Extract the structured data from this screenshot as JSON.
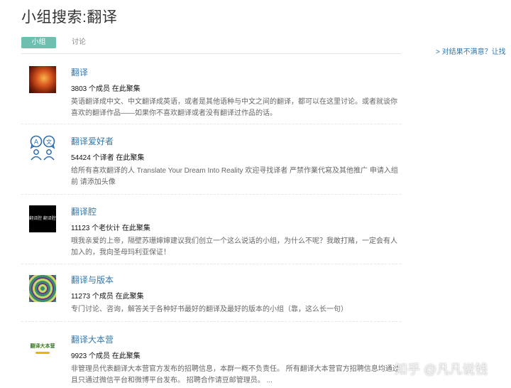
{
  "page_title": "小组搜索:翻译",
  "tabs": [
    {
      "label": "小组",
      "active": true
    },
    {
      "label": "讨论",
      "active": false
    }
  ],
  "side_link": "> 对结果不满意？让找",
  "groups": [
    {
      "name": "翻译",
      "count": "3803 个成员 在此聚集",
      "description": "英语翻译成中文、中文翻译成英语，或者是其他语种与中文之间的翻译，都可以在这里讨论。或者就谈你喜欢的翻译作品——如果你不喜欢翻译或者没有翻译过作品的话。",
      "icon": "fire-face-avatar"
    },
    {
      "name": "翻译爱好者",
      "count": "54424 个译者 在此聚集",
      "description": "给所有喜欢翻译的人 Translate Your Dream Into Reality  欢迎寻找译者  严禁作業代寫及其他推广 申请入组前 请添加头像",
      "icon": "translation-chat-icon"
    },
    {
      "name": "翻译腔",
      "count": "11123 个老伙计 在此聚集",
      "description": "哦我亲爱的上帝，隔壁苏珊婶婶建议我们创立一个这么说话的小组，为什么不呢？我敢打赌，一定会有人加入的，我向圣母玛利亚保证！",
      "icon": "dark-text-avatar",
      "icon_text": "翻译腔 翻译腔"
    },
    {
      "name": "翻译与版本",
      "count": "11273 个成员 在此聚集",
      "description": "专门讨论、咨询，解答关于各种好书最好的翻译及最好的版本的小组（靠，这么长一句）",
      "icon": "pattern-avatar"
    },
    {
      "name": "翻译大本营",
      "count": "9923 个成员 在此聚集",
      "description": "非管理员代表翻译大本营官方发布的招聘信息，本群一概不负责任。 所有翻译大本营官方招聘信息均通过且只通过微信平台和微博平台发布。 招聘合作请豆邮管理员。 ...",
      "icon": "camp-logo-avatar",
      "icon_text": "翻译大本营"
    }
  ],
  "watermark": "知乎 @凡凡说钱"
}
